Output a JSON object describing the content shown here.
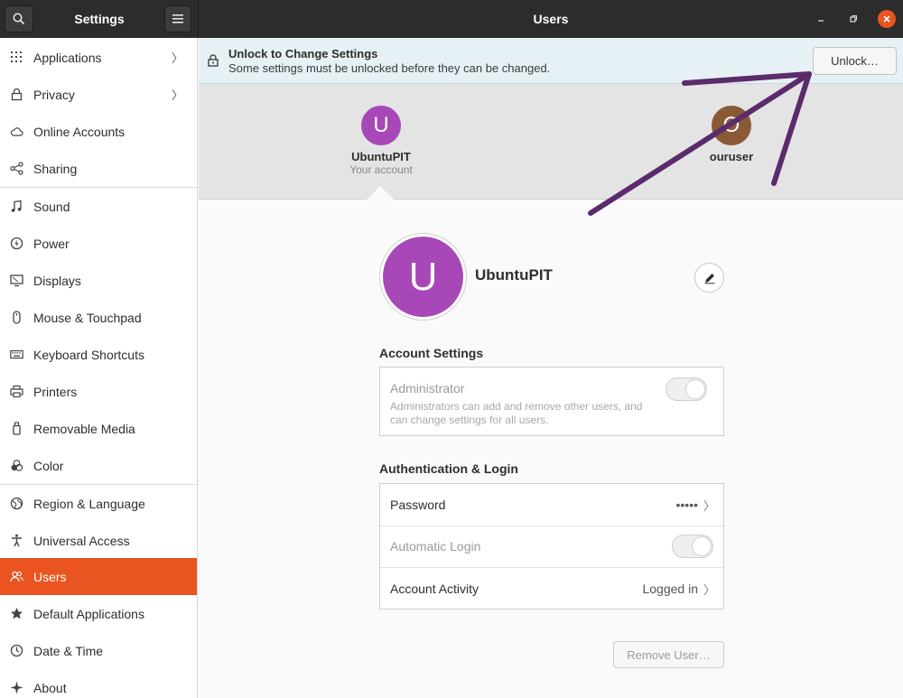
{
  "header": {
    "settings_title": "Settings",
    "window_title": "Users",
    "minimize_icon": "minimize-icon",
    "maximize_icon": "restore-icon",
    "close_icon": "close-icon"
  },
  "sidebar": {
    "items": [
      {
        "label": "Applications",
        "icon": "grid-icon",
        "chevron": "〉"
      },
      {
        "label": "Privacy",
        "icon": "lock-icon",
        "chevron": "〉"
      },
      {
        "label": "Online Accounts",
        "icon": "cloud-icon"
      },
      {
        "label": "Sharing",
        "icon": "share-icon"
      },
      {
        "label": "Sound",
        "icon": "music-icon"
      },
      {
        "label": "Power",
        "icon": "power-icon"
      },
      {
        "label": "Displays",
        "icon": "display-icon"
      },
      {
        "label": "Mouse & Touchpad",
        "icon": "mouse-icon"
      },
      {
        "label": "Keyboard Shortcuts",
        "icon": "keyboard-icon"
      },
      {
        "label": "Printers",
        "icon": "printer-icon"
      },
      {
        "label": "Removable Media",
        "icon": "usb-icon"
      },
      {
        "label": "Color",
        "icon": "color-icon"
      },
      {
        "label": "Region & Language",
        "icon": "globe-icon"
      },
      {
        "label": "Universal Access",
        "icon": "accessibility-icon"
      },
      {
        "label": "Users",
        "icon": "users-icon",
        "active": true
      },
      {
        "label": "Default Applications",
        "icon": "star-icon"
      },
      {
        "label": "Date & Time",
        "icon": "clock-icon"
      },
      {
        "label": "About",
        "icon": "about-icon"
      }
    ]
  },
  "infobar": {
    "title": "Unlock to Change Settings",
    "message": "Some settings must be unlocked before they can be changed.",
    "unlock_label": "Unlock…"
  },
  "users": {
    "current": {
      "initial": "U",
      "name": "UbuntuPIT",
      "subtitle": "Your account"
    },
    "other": {
      "initial": "O",
      "name": "ouruser"
    }
  },
  "detail": {
    "initial": "U",
    "name": "UbuntuPIT",
    "account_settings_title": "Account Settings",
    "admin_label": "Administrator",
    "admin_desc_1": "Administrators can add and remove other users, and",
    "admin_desc_2": "can change settings for all users.",
    "auth_title": "Authentication & Login",
    "password_label": "Password",
    "password_value": "•••••",
    "autologin_label": "Automatic Login",
    "activity_label": "Account Activity",
    "activity_value": "Logged in",
    "remove_label": "Remove User…"
  },
  "colors": {
    "accent": "#e95420",
    "avatar_purple": "#a848b8",
    "avatar_brown": "#8a5a36",
    "annotation_arrow": "#5b2b6b"
  }
}
